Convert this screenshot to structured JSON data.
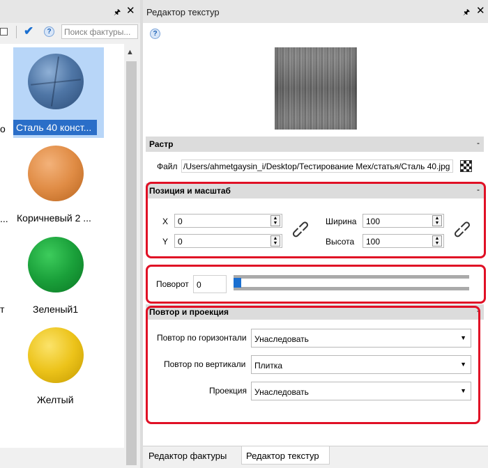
{
  "library": {
    "search_placeholder": "Поиск фактуры...",
    "materials": [
      {
        "label": "Сталь 40 конст...",
        "selected": true
      },
      {
        "label": "Коричневый 2 ..."
      },
      {
        "label": "Зеленый1"
      },
      {
        "label": "Желтый"
      }
    ],
    "edge_fragments": [
      "о",
      "...",
      "т"
    ]
  },
  "editor": {
    "title": "Редактор текстур",
    "raster": {
      "header": "Растр",
      "file_label": "Файл",
      "file_path": "/Users/ahmetgaysin_i/Desktop/Тестирование Мех/статья/Сталь 40.jpg"
    },
    "position": {
      "header": "Позиция и масштаб",
      "x_label": "X",
      "x_value": "0",
      "y_label": "Y",
      "y_value": "0",
      "width_label": "Ширина",
      "width_value": "100",
      "height_label": "Высота",
      "height_value": "100"
    },
    "rotation": {
      "label": "Поворот",
      "value": "0"
    },
    "repeat": {
      "header": "Повтор и проекция",
      "horizontal_label": "Повтор по горизонтали",
      "horizontal_value": "Унаследовать",
      "vertical_label": "Повтор по вертикали",
      "vertical_value": "Плитка",
      "projection_label": "Проекция",
      "projection_value": "Унаследовать"
    },
    "collapse_symbol": "-"
  },
  "tabs": {
    "material_editor": "Редактор фактуры",
    "texture_editor": "Редактор текстур"
  },
  "colors": {
    "accent": "#1a6fd0",
    "selection": "#2a6ec8",
    "highlight_box": "#e01025"
  }
}
